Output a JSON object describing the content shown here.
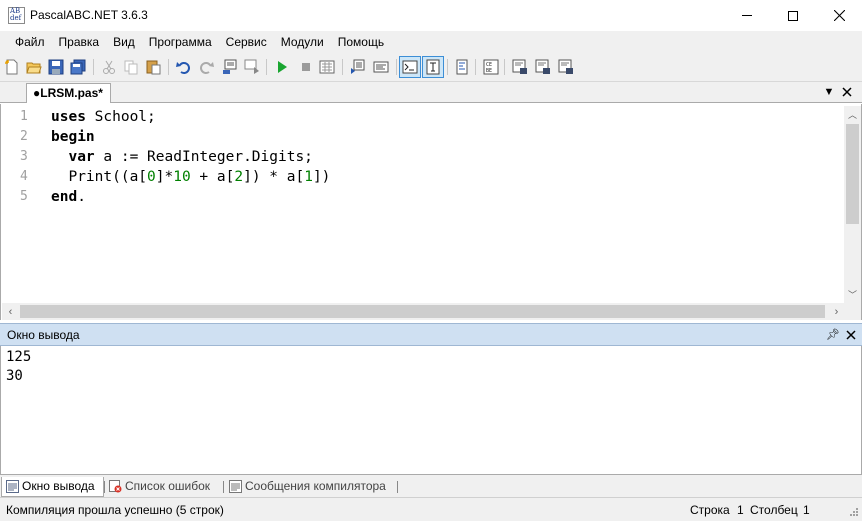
{
  "window": {
    "title": "PascalABC.NET 3.6.3",
    "icon_text": [
      "AB",
      "def"
    ]
  },
  "menu": [
    "Файл",
    "Правка",
    "Вид",
    "Программа",
    "Сервис",
    "Модули",
    "Помощь"
  ],
  "toolbar": {
    "icons": [
      "new-file-icon",
      "open-file-icon",
      "save-icon",
      "save-all-icon",
      "cut-icon",
      "copy-icon",
      "paste-icon",
      "undo-icon",
      "redo-icon",
      "compile-icon",
      "compile-all-icon",
      "run-icon",
      "stop-icon",
      "debug-step-icon",
      "comment-icon",
      "uncomment-icon",
      "console-window-icon",
      "text-window-icon",
      "format-icon",
      "code-templates-icon",
      "debug-into-icon",
      "debug-over-icon",
      "debug-run-to-icon"
    ]
  },
  "editor": {
    "tab_label": "●LRSM.pas*",
    "line_numbers": [
      "1",
      "2",
      "3",
      "4",
      "5"
    ],
    "lines": [
      [
        {
          "t": "uses",
          "c": "kw"
        },
        {
          "t": " School;",
          "c": ""
        }
      ],
      [
        {
          "t": "begin",
          "c": "kw"
        }
      ],
      [
        {
          "t": "  ",
          "c": ""
        },
        {
          "t": "var",
          "c": "kw"
        },
        {
          "t": " a := ReadInteger.Digits;",
          "c": ""
        }
      ],
      [
        {
          "t": "  Print((a[",
          "c": ""
        },
        {
          "t": "0",
          "c": "num"
        },
        {
          "t": "]*",
          "c": ""
        },
        {
          "t": "10",
          "c": "num"
        },
        {
          "t": " + a[",
          "c": ""
        },
        {
          "t": "2",
          "c": "num"
        },
        {
          "t": "]) * a[",
          "c": ""
        },
        {
          "t": "1",
          "c": "num"
        },
        {
          "t": "])",
          "c": ""
        }
      ],
      [
        {
          "t": "end",
          "c": "kw"
        },
        {
          "t": ".",
          "c": ""
        }
      ]
    ]
  },
  "output_panel": {
    "title": "Окно вывода",
    "lines": [
      "125",
      "30"
    ]
  },
  "bottom_tabs": [
    {
      "label": "Окно вывода",
      "active": true
    },
    {
      "label": "Список ошибок",
      "active": false
    },
    {
      "label": "Сообщения компилятора",
      "active": false
    }
  ],
  "status": {
    "message": "Компиляция прошла успешно (5 строк)",
    "line_label": "Строка",
    "line_value": "1",
    "col_label": "Столбец",
    "col_value": "1"
  }
}
